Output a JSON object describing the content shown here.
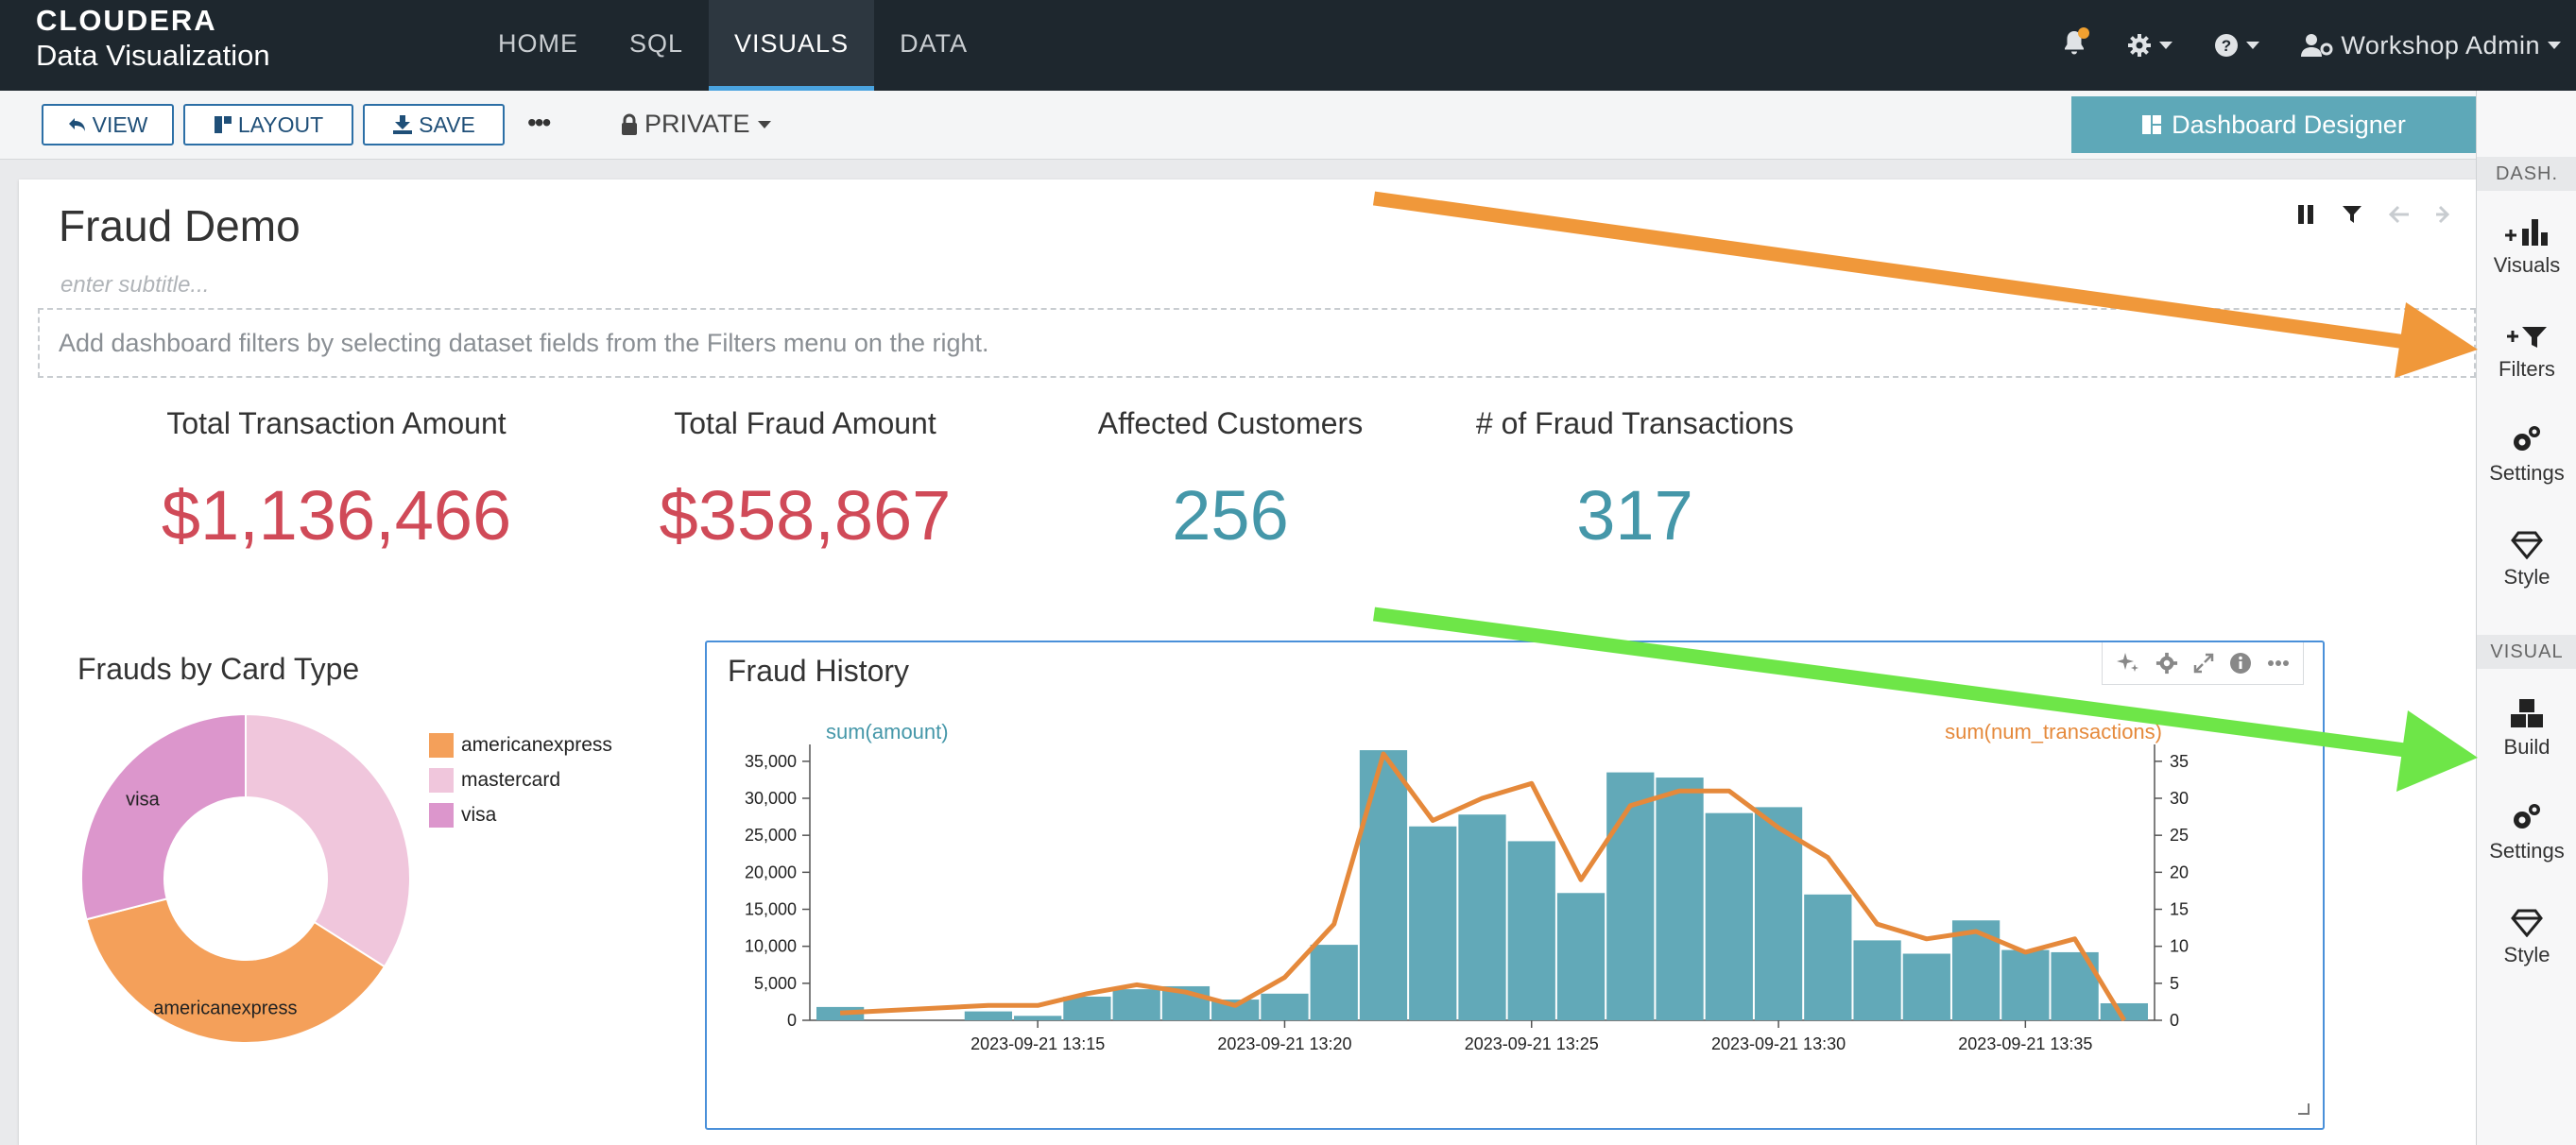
{
  "app": {
    "brand": "CLOUDERA",
    "product": "Data Visualization"
  },
  "nav": {
    "items": [
      "HOME",
      "SQL",
      "VISUALS",
      "DATA"
    ],
    "active": "VISUALS"
  },
  "user": {
    "name": "Workshop Admin"
  },
  "toolbar": {
    "view_label": "VIEW",
    "layout_label": "LAYOUT",
    "save_label": "SAVE",
    "more_label": "•••",
    "privacy_label": "PRIVATE",
    "designer_label": "Dashboard Designer"
  },
  "sidebar": {
    "dash_header": "DASH.",
    "dash_items": [
      "Visuals",
      "Filters",
      "Settings",
      "Style"
    ],
    "visual_header": "VISUAL",
    "visual_items": [
      "Build",
      "Settings",
      "Style"
    ]
  },
  "dashboard": {
    "title": "Fraud Demo",
    "subtitle_placeholder": "enter subtitle...",
    "filter_hint": "Add dashboard filters by selecting dataset fields from the Filters menu on the right."
  },
  "kpis": [
    {
      "label": "Total Transaction Amount",
      "value": "$1,136,466",
      "color": "#d04a58"
    },
    {
      "label": "Total Fraud Amount",
      "value": "$358,867",
      "color": "#d04a58"
    },
    {
      "label": "Affected Customers",
      "value": "256",
      "color": "#4597a9"
    },
    {
      "label": "# of Fraud Transactions",
      "value": "317",
      "color": "#4597a9"
    }
  ],
  "chart_data": [
    {
      "type": "pie",
      "title": "Frauds by Card Type",
      "donut": true,
      "categories": [
        "mastercard",
        "americanexpress",
        "visa"
      ],
      "values": [
        34,
        37,
        29
      ],
      "colors": {
        "americanexpress": "#f4a05a",
        "mastercard": "#f0c6dc",
        "visa": "#dc96cc"
      },
      "legend": [
        "americanexpress",
        "mastercard",
        "visa"
      ],
      "slice_labels": [
        "americanexpress",
        "visa"
      ],
      "legend_position": "right"
    },
    {
      "type": "bar",
      "title": "Fraud History",
      "series": [
        {
          "name": "sum(amount)",
          "kind": "bar",
          "axis": "left",
          "color": "#62a9b8",
          "values": [
            1800,
            0,
            0,
            1200,
            600,
            3200,
            4200,
            4600,
            2800,
            3600,
            10200,
            36500,
            26200,
            27800,
            24200,
            17200,
            33500,
            32800,
            28000,
            28800,
            17000,
            10800,
            9000,
            13500,
            9500,
            9200,
            2300
          ]
        },
        {
          "name": "sum(num_transactions)",
          "kind": "line",
          "axis": "right",
          "color": "#e5893b",
          "points": [
            [
              0,
              1
            ],
            [
              3,
              2
            ],
            [
              4,
              2
            ],
            [
              5,
              3.6
            ],
            [
              6,
              4.8
            ],
            [
              7,
              3.8
            ],
            [
              8,
              2
            ],
            [
              9,
              5.8
            ],
            [
              10,
              13
            ],
            [
              11,
              36
            ],
            [
              12,
              27
            ],
            [
              13,
              30
            ],
            [
              14,
              32
            ],
            [
              15,
              19
            ],
            [
              16,
              29
            ],
            [
              17,
              31
            ],
            [
              18,
              31
            ],
            [
              19,
              26
            ],
            [
              20,
              22
            ],
            [
              21,
              13
            ],
            [
              22,
              11
            ],
            [
              23,
              12
            ],
            [
              24,
              9.2
            ],
            [
              25,
              11
            ],
            [
              26,
              0
            ]
          ]
        }
      ],
      "x_ticks": [
        "2023-09-21 13:15",
        "2023-09-21 13:20",
        "2023-09-21 13:25",
        "2023-09-21 13:30",
        "2023-09-21 13:35"
      ],
      "x_tick_bins": [
        4.5,
        9.5,
        14.5,
        19.5,
        24.5
      ],
      "ylim_left": [
        0,
        36000
      ],
      "yticks_left": [
        0,
        5000,
        10000,
        15000,
        20000,
        25000,
        30000,
        35000
      ],
      "ylim_right": [
        0,
        36
      ],
      "yticks_right": [
        0,
        5,
        10,
        15,
        20,
        25,
        30,
        35
      ],
      "ylabel_left": "sum(amount)",
      "ylabel_right": "sum(num_transactions)"
    }
  ]
}
